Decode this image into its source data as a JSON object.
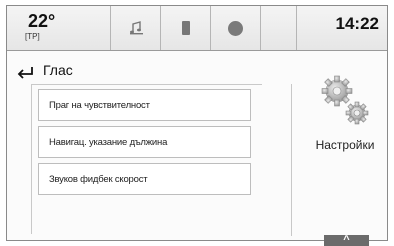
{
  "status": {
    "temperature": "22°",
    "temp_mode": "[TP]",
    "time": "14:22",
    "icons": [
      "music-note-icon",
      "phone-icon",
      "record-icon"
    ]
  },
  "header": {
    "title": "Глас",
    "back_icon": "back-arrow-icon"
  },
  "menu": {
    "items": [
      {
        "label": "Праг на чувствителност"
      },
      {
        "label": "Навигац. указание дължина"
      },
      {
        "label": "Звуков фидбек скорост"
      }
    ]
  },
  "settings": {
    "label": "Настройки",
    "icon": "gears-icon"
  },
  "scroll": {
    "up_symbol": "^"
  }
}
